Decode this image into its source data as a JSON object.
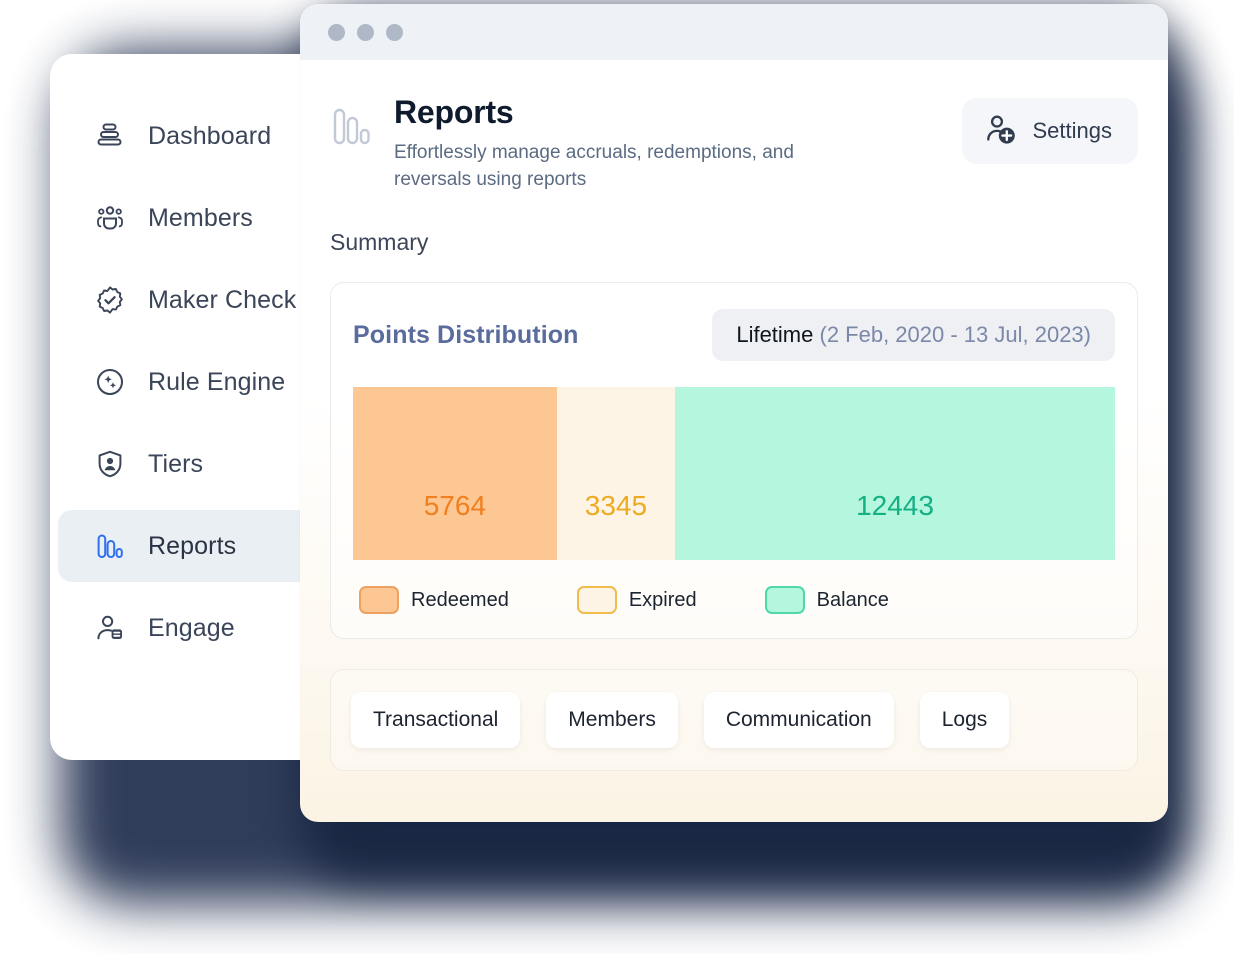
{
  "window": {
    "traffic_lights": [
      "close",
      "minimize",
      "maximize"
    ]
  },
  "sidebar": {
    "items": [
      {
        "label": "Dashboard",
        "icon": "dashboard-icon",
        "active": false
      },
      {
        "label": "Members",
        "icon": "members-icon",
        "active": false
      },
      {
        "label": "Maker Check",
        "icon": "verified-check-icon",
        "active": false
      },
      {
        "label": "Rule Engine",
        "icon": "rule-engine-icon",
        "active": false
      },
      {
        "label": "Tiers",
        "icon": "shield-user-icon",
        "active": false
      },
      {
        "label": "Reports",
        "icon": "bar-chart-icon",
        "active": true
      },
      {
        "label": "Engage",
        "icon": "engage-user-icon",
        "active": false
      }
    ]
  },
  "header": {
    "icon": "bar-chart-icon",
    "title": "Reports",
    "subtitle": "Effortlessly manage accruals, redemptions, and reversals using reports",
    "settings_label": "Settings",
    "settings_icon": "add-user-icon"
  },
  "summary": {
    "heading": "Summary"
  },
  "chart_card": {
    "title": "Points Distribution",
    "range_label": "Lifetime",
    "range_dates": "(2 Feb, 2020 - 13 Jul, 2023)"
  },
  "tabs": [
    {
      "label": "Transactional"
    },
    {
      "label": "Members"
    },
    {
      "label": "Communication"
    },
    {
      "label": "Logs"
    }
  ],
  "colors": {
    "accent_blue": "#2f6ff0",
    "redeemed_fill": "#fcc793",
    "redeemed_text": "#ef7f1f",
    "redeemed_border": "#efa260",
    "expired_fill": "#fdf4e6",
    "expired_text": "#edab23",
    "expired_border": "#f0bc4c",
    "balance_fill": "#b5f6de",
    "balance_text": "#13b083",
    "balance_border": "#4fd9ab",
    "sidebar_active_bg": "#eaeff4",
    "titlebar_bg": "#eef1f5",
    "shadow": "#1f2d4d"
  },
  "chart_data": {
    "type": "bar",
    "title": "Points Distribution",
    "subtitle": "Lifetime (2 Feb, 2020 - 13 Jul, 2023)",
    "orientation": "horizontal-stacked",
    "categories": [
      "Redeemed",
      "Expired",
      "Balance"
    ],
    "values": [
      5764,
      3345,
      12443
    ],
    "value_labels": [
      "5764",
      "3345",
      "12443"
    ],
    "total": 21552,
    "percentages": [
      26.7,
      15.5,
      57.7
    ],
    "colors": [
      "#fcc793",
      "#fdf4e6",
      "#b5f6de"
    ],
    "label_colors": [
      "#ef7f1f",
      "#edab23",
      "#13b083"
    ],
    "legend": [
      {
        "label": "Redeemed",
        "fill": "#fcc793",
        "border": "#efa260"
      },
      {
        "label": "Expired",
        "fill": "#fdf4e6",
        "border": "#f0bc4c"
      },
      {
        "label": "Balance",
        "fill": "#b5f6de",
        "border": "#4fd9ab"
      }
    ],
    "legend_position": "bottom-left",
    "grid": false,
    "xlabel": "",
    "ylabel": ""
  }
}
